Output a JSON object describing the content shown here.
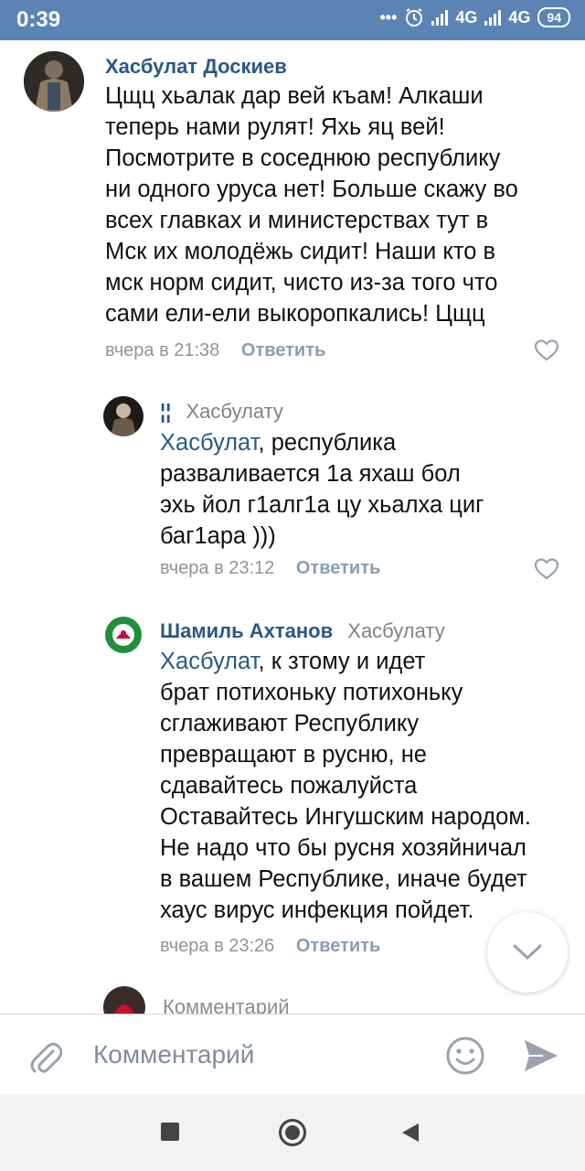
{
  "status_bar": {
    "time": "0:39",
    "network_1": "4G",
    "network_2": "4G",
    "battery": "94"
  },
  "comments": [
    {
      "author": "Хасбулат Доскиев",
      "text": "Цщц хьалак дар вей къам! Алкаши\nтеперь нами рулят! Яхь яц вей!\nПосмотрите в соседнюю республику\nни одного уруса нет! Больше скажу во\nвсех главках и министерствах тут в\nМск их молодёжь сидит! Наши кто в\nмск норм сидит, чисто из-за того что\nсами ели-ели выкоропкались! Цщц",
      "time": "вчера в 21:38",
      "reply_label": "Ответить"
    },
    {
      "author": "¦¦",
      "reply_to": "Хасбулату",
      "mention": "Хасбулат",
      "text": ", республика\nразваливается 1а яхаш бол\nэхь йол г1алг1а цу хьалха циг\nбаг1ара )))",
      "time": "вчера в 23:12",
      "reply_label": "Ответить"
    },
    {
      "author": "Шамиль Ахтанов",
      "reply_to": "Хасбулату",
      "mention": "Хасбулат",
      "text": ", к зтому и идет\nбрат потихоньку потихоньку\nсглаживают Республику\nпревращают в русню,  не\nсдавайтесь пожалуйста\nОставайтесь Ингушским народом.\nНе надо что бы русня хозяйничал\nв вашем Республике,  иначе будет\nхаус вирус инфекция пойдет.",
      "time": "вчера в 23:26",
      "reply_label": "Ответить"
    }
  ],
  "partial_comment_text": "Комментарий",
  "composer": {
    "placeholder": "Комментарий"
  },
  "colors": {
    "status_bar": "#5b84b4",
    "link": "#2a5885",
    "meta": "#939393",
    "icon": "#99a2ad"
  }
}
